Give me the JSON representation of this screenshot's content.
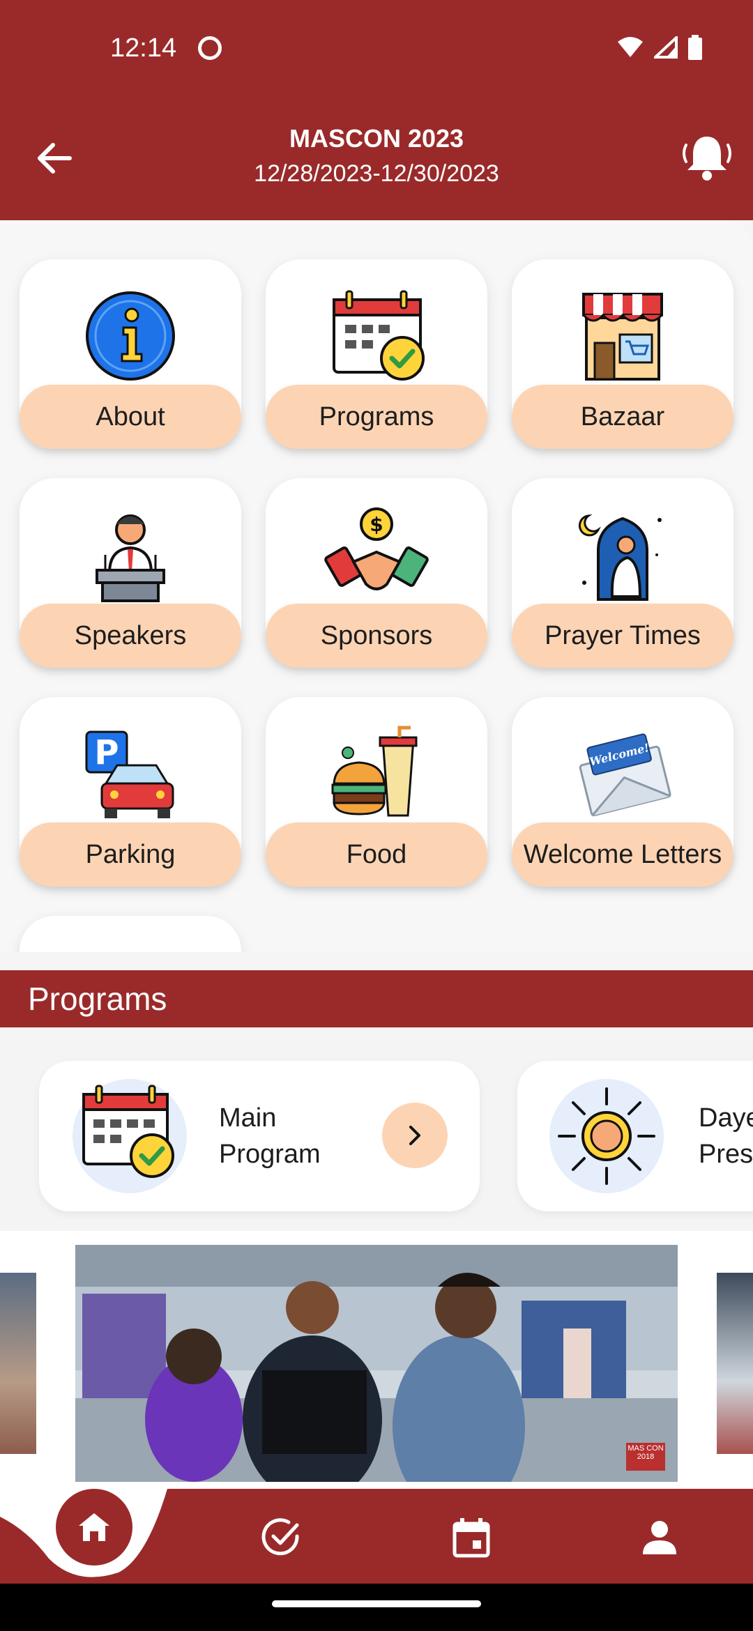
{
  "status": {
    "time": "12:14"
  },
  "header": {
    "title": "MASCON 2023",
    "dates": "12/28/2023-12/30/2023"
  },
  "tiles": [
    {
      "label": "About",
      "icon": "info-icon"
    },
    {
      "label": "Programs",
      "icon": "calendar-check-icon"
    },
    {
      "label": "Bazaar",
      "icon": "shop-icon"
    },
    {
      "label": "Speakers",
      "icon": "speaker-podium-icon"
    },
    {
      "label": "Sponsors",
      "icon": "handshake-icon"
    },
    {
      "label": "Prayer Times",
      "icon": "prayer-icon"
    },
    {
      "label": "Parking",
      "icon": "parking-icon"
    },
    {
      "label": "Food",
      "icon": "food-icon"
    },
    {
      "label": "Welcome Letters",
      "icon": "envelope-icon"
    }
  ],
  "programs": {
    "section_title": "Programs",
    "cards": [
      {
        "line1": "Main",
        "line2": "Program",
        "icon": "calendar-check-icon"
      },
      {
        "line1": "Daye",
        "line2": "Pres",
        "icon": "sun-icon"
      }
    ]
  },
  "banner": {
    "badge": "MAS CON 2018"
  },
  "colors": {
    "brand": "#9a2a2a",
    "accent": "#fcd4b4"
  }
}
